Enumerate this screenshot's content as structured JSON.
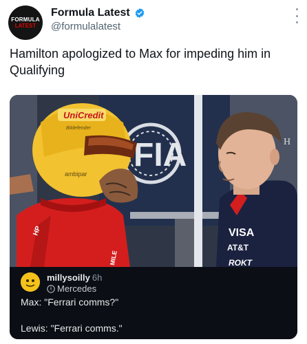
{
  "account": {
    "avatar_line1": "FORMULA",
    "avatar_line2": "LATEST",
    "display_name": "Formula Latest",
    "handle": "@formulalatest",
    "verified_color": "#1d9bf0"
  },
  "tweet": {
    "text": "Hamilton apologized to Max for impeding him in Qualifying"
  },
  "media": {
    "helmet_text": "UniCredit",
    "helmet_text_small": "Bitdefender",
    "helmet_chin": "ambipar",
    "backdrop_logo": "FIA",
    "backdrop_edge": "H",
    "left_shirt_text": "HP",
    "right_shirt_visa": "VISA",
    "right_shirt_att": "AT&T",
    "right_shirt_bottom": "ROKT",
    "left_shirt_mile": "MILE",
    "helmet_color": "#f2c230",
    "ferrari_red": "#d41e1e",
    "redbull_navy": "#1b2240"
  },
  "quoted_reply": {
    "username": "millysoilly",
    "time": "6h",
    "team": "Mercedes",
    "line1": "Max: \"Ferrari comms?\"",
    "line2": "Lewis: \"Ferrari comms.\""
  }
}
